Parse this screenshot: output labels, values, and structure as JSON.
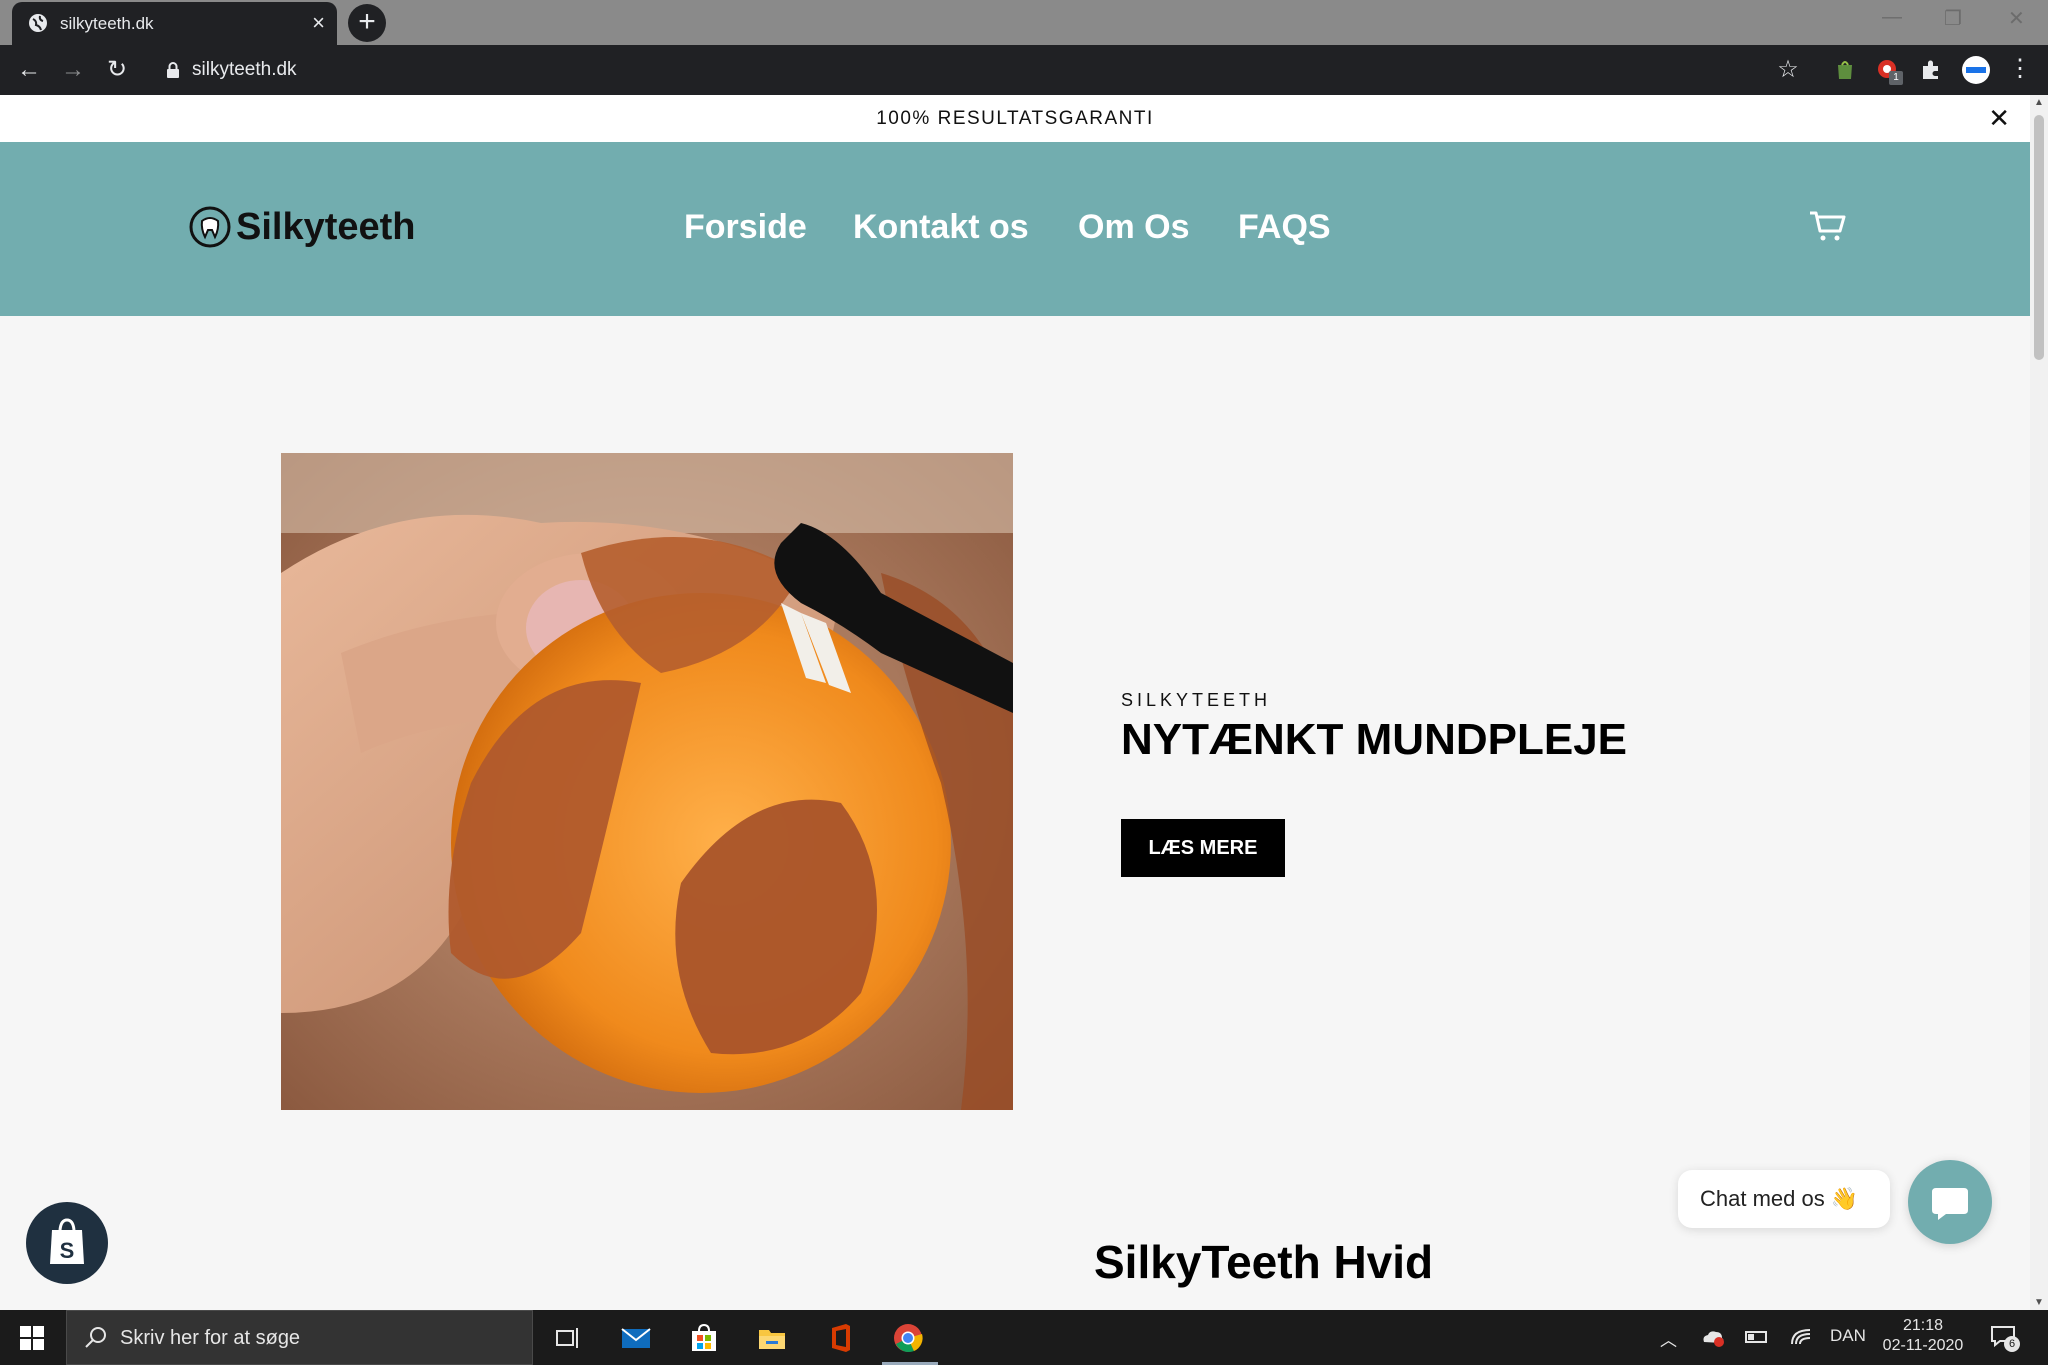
{
  "browser": {
    "tab_title": "silkyteeth.dk",
    "url": "silkyteeth.dk"
  },
  "announcement": {
    "text": "100% RESULTATSGARANTI"
  },
  "header": {
    "logo_text": "Silkyteeth",
    "nav": [
      "Forside",
      "Kontakt os",
      "Om Os",
      "FAQS"
    ]
  },
  "hero": {
    "eyebrow": "SILKYTEETH",
    "title": "NYTÆNKT MUNDPLEJE",
    "button": "LÆS MERE"
  },
  "section": {
    "title": "SilkyTeeth Hvid"
  },
  "chat": {
    "label": "Chat med os",
    "emoji": "👋"
  },
  "taskbar": {
    "search_placeholder": "Skriv her for at søge",
    "language": "DAN",
    "time": "21:18",
    "date": "02-11-2020",
    "notification_count": "6"
  },
  "extensions": {
    "badge": "1"
  },
  "colors": {
    "header_bg": "#72adaf",
    "button_bg": "#000000",
    "chrome_dark": "#202124"
  }
}
